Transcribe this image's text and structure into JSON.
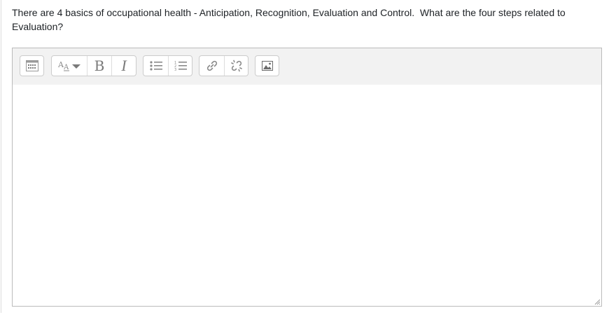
{
  "question": {
    "text": "There are 4 basics of occupational health - Anticipation, Recognition, Evaluation and Control.  What are the four steps related to Evaluation?"
  },
  "editor": {
    "content": "",
    "toolbar": {
      "groups": [
        {
          "name": "more",
          "buttons": [
            {
              "icon": "toolbar-toggle-icon",
              "title": "Show more buttons"
            }
          ]
        },
        {
          "name": "style",
          "buttons": [
            {
              "icon": "paragraph-styles-icon",
              "title": "Paragraph styles"
            },
            {
              "icon": "bold-icon",
              "label": "B",
              "title": "Bold"
            },
            {
              "icon": "italic-icon",
              "label": "I",
              "title": "Italic"
            }
          ]
        },
        {
          "name": "list",
          "buttons": [
            {
              "icon": "unordered-list-icon",
              "title": "Unordered list"
            },
            {
              "icon": "ordered-list-icon",
              "title": "Ordered list"
            }
          ]
        },
        {
          "name": "links",
          "buttons": [
            {
              "icon": "link-icon",
              "title": "Link"
            },
            {
              "icon": "unlink-icon",
              "title": "Unlink"
            }
          ]
        },
        {
          "name": "files",
          "buttons": [
            {
              "icon": "image-icon",
              "title": "Insert or edit image"
            }
          ]
        }
      ]
    }
  },
  "colors": {
    "toolbar_bg": "#f2f2f2",
    "border": "#bbbbbb",
    "icon": "#8a8a8a",
    "text": "#1d2125"
  }
}
